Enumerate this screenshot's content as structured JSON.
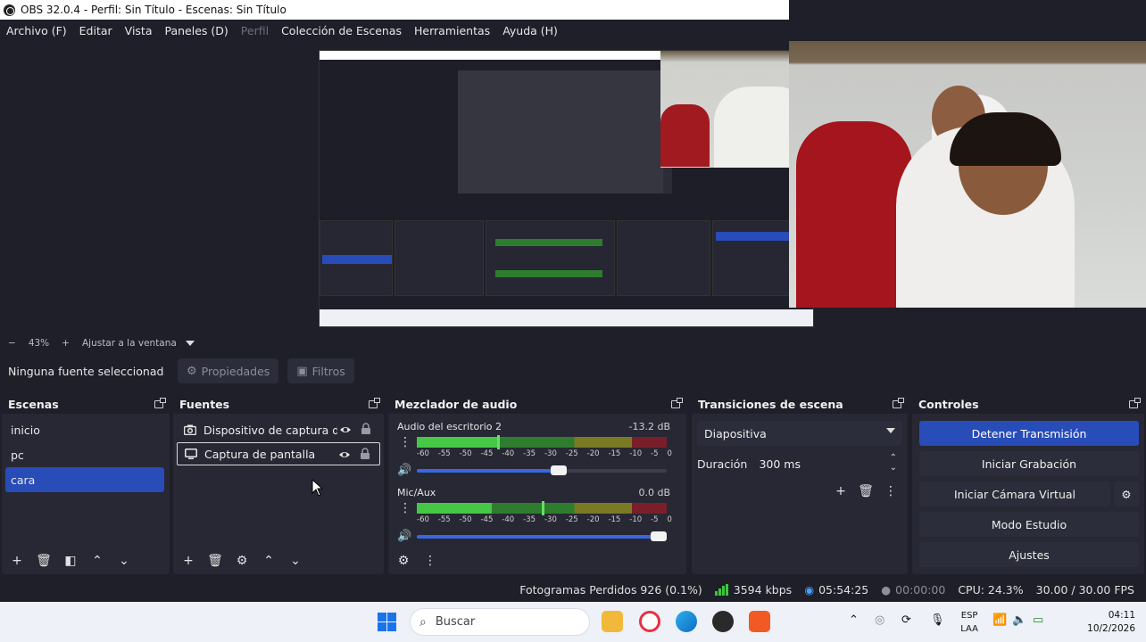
{
  "window": {
    "title": "OBS 32.0.4 - Perfil: Sin Título - Escenas: Sin Título"
  },
  "menu": [
    {
      "label": "Archivo (F)",
      "enabled": true
    },
    {
      "label": "Editar",
      "enabled": true
    },
    {
      "label": "Vista",
      "enabled": true
    },
    {
      "label": "Paneles (D)",
      "enabled": true
    },
    {
      "label": "Perfil",
      "enabled": false
    },
    {
      "label": "Colección de Escenas",
      "enabled": true
    },
    {
      "label": "Herramientas",
      "enabled": true
    },
    {
      "label": "Ayuda (H)",
      "enabled": true
    }
  ],
  "zoom": {
    "minus": "−",
    "value": "43%",
    "plus": "+",
    "fit_label": "Ajustar a la ventana"
  },
  "context": {
    "no_source": "Ninguna fuente seleccionad",
    "properties": "Propiedades",
    "filters": "Filtros"
  },
  "scenes": {
    "title": "Escenas",
    "items": [
      {
        "label": "inicio"
      },
      {
        "label": "pc"
      },
      {
        "label": "cara"
      }
    ],
    "selected": "cara"
  },
  "sources": {
    "title": "Fuentes",
    "items": [
      {
        "label": "Dispositivo de captura de video",
        "icon": "camera-icon"
      },
      {
        "label": "Captura de pantalla",
        "icon": "monitor-icon"
      }
    ]
  },
  "mixer": {
    "title": "Mezclador de audio",
    "channels": [
      {
        "name": "Audio del escritorio 2",
        "db": "-13.2 dB",
        "level": 0.33,
        "peak": 0.32,
        "volume": 0.58
      },
      {
        "name": "Mic/Aux",
        "db": "0.0 dB",
        "level": 0.3,
        "peak": 0.5,
        "volume": 0.98
      }
    ],
    "ticks": [
      "-60",
      "-55",
      "-50",
      "-45",
      "-40",
      "-35",
      "-30",
      "-25",
      "-20",
      "-15",
      "-10",
      "-5",
      "0"
    ]
  },
  "transitions": {
    "title": "Transiciones de escena",
    "selected": "Diapositiva",
    "duration_label": "Duración",
    "duration_value": "300 ms"
  },
  "controls": {
    "title": "Controles",
    "buttons": [
      "Detener Transmisión",
      "Iniciar Grabación",
      "Iniciar Cámara Virtual",
      "Modo Estudio",
      "Ajustes"
    ]
  },
  "status": {
    "dropped": "Fotogramas Perdidos 926 (0.1%)",
    "bitrate": "3594 kbps",
    "stream_time": "05:54:25",
    "rec_time": "00:00:00",
    "cpu": "CPU: 24.3%",
    "fps": "30.00 / 30.00 FPS"
  },
  "taskbar": {
    "search_placeholder": "Buscar",
    "lang_top": "ESP",
    "lang_bottom": "LAA",
    "time": "04:11",
    "date": "10/2/2026"
  },
  "colors": {
    "accent": "#284cb8",
    "bg": "#1e1f29",
    "panel": "#272834"
  }
}
